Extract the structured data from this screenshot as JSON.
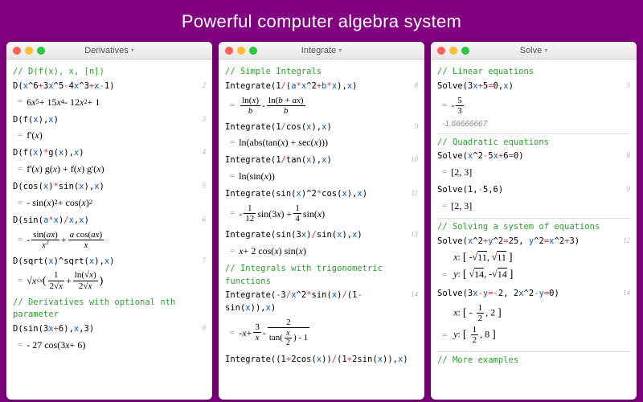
{
  "tagline": "Powerful computer algebra system",
  "panes": [
    {
      "title": "Derivatives",
      "rows": [
        {
          "type": "cmt",
          "t": "// D(f(x), x, [n])"
        },
        {
          "type": "io",
          "n": "2",
          "in": "D(x^6+3x^5-4x^3+x-1)",
          "out": "6x⁵ + 15x⁴ - 12x² + 1"
        },
        {
          "type": "io",
          "n": "3",
          "in": "D(f(x),x)",
          "out": "f'(x)"
        },
        {
          "type": "io",
          "n": "4",
          "in": "D(f(x)*g(x),x)",
          "out": "f'(x) g(x) + f(x) g'(x)"
        },
        {
          "type": "io",
          "n": "5",
          "in": "D(cos(x)*sin(x),x)",
          "out": "- sin(x)² + cos(x)²"
        },
        {
          "type": "io",
          "n": "6",
          "in": "D(sin(a*x)/x,x)",
          "out_frac": [
            "- sin(ax)/x²",
            " + a cos(ax)/x"
          ]
        },
        {
          "type": "io",
          "n": "7",
          "in": "D(sqrt(x)^sqrt(x),x)",
          "out": "√x^√x ( 1/(2√x) + ln(√x)/(2√x) )"
        },
        {
          "type": "cmt",
          "t": "// Derivatives with optional nth parameter"
        },
        {
          "type": "io",
          "n": "8",
          "in": "D(sin(3x+6),x,3)",
          "out": "- 27 cos(3x + 6)"
        }
      ]
    },
    {
      "title": "Integrate",
      "rows": [
        {
          "type": "cmt",
          "t": "// Simple Integrals"
        },
        {
          "type": "io",
          "n": "8",
          "in": "Integrate(1/(a*x^2+b*x),x)",
          "out": "ln(x)/b - ln(b + ax)/b"
        },
        {
          "type": "io",
          "n": "9",
          "in": "Integrate(1/cos(x),x)",
          "out": "ln(abs(tan(x) + sec(x)))"
        },
        {
          "type": "io",
          "n": "10",
          "in": "Integrate(1/tan(x),x)",
          "out": "ln(sin(x))"
        },
        {
          "type": "io",
          "n": "11",
          "in": "Integrate(sin(x)^2*cos(x),x)",
          "out": "- 1/12 sin(3x) + 1/4 sin(x)"
        },
        {
          "type": "io",
          "n": "13",
          "in": "Integrate(sin(3x)/sin(x),x)",
          "out": "x + 2 cos(x) sin(x)"
        },
        {
          "type": "cmt",
          "t": "// Integrals with trigonometric functions"
        },
        {
          "type": "io",
          "n": "14",
          "in": "Integrate(-3/x^2*sin(x)/(1-sin(x)),x)",
          "out": "- x + 3/x - 2 / (tan(x/2) - 1)"
        },
        {
          "type": "io",
          "n": "",
          "in": "Integrate((1+2cos(x))/(1+2sin(x)),x)",
          "out": ""
        }
      ]
    },
    {
      "title": "Solve",
      "rows": [
        {
          "type": "cmt",
          "t": "// Linear equations"
        },
        {
          "type": "io",
          "n": "5",
          "in": "Solve(3x+5=0,x)",
          "out": "- 5/3",
          "sub": "-1.66666667"
        },
        {
          "type": "cmt",
          "t": "// Quadratic equations"
        },
        {
          "type": "io",
          "n": "8",
          "in": "Solve(x^2-5x+6=0)",
          "out": "[2, 3]"
        },
        {
          "type": "io",
          "n": "9",
          "in": "Solve(1,-5,6)",
          "out": "[2, 3]"
        },
        {
          "type": "cmt",
          "t": "// Solving a system of equations"
        },
        {
          "type": "io",
          "n": "12",
          "in": "Solve(x^2+y^2=25, y^2=x^2+3)",
          "out": "x: [-√11, √11]  y: [√14, -√14]"
        },
        {
          "type": "io",
          "n": "14",
          "in": "Solve(3x-y=-2, 2x^2-y=0)",
          "out": "x: [-1/2, 2]  y: [1/2, 8]"
        },
        {
          "type": "cmt",
          "t": "// More examples"
        }
      ]
    }
  ]
}
